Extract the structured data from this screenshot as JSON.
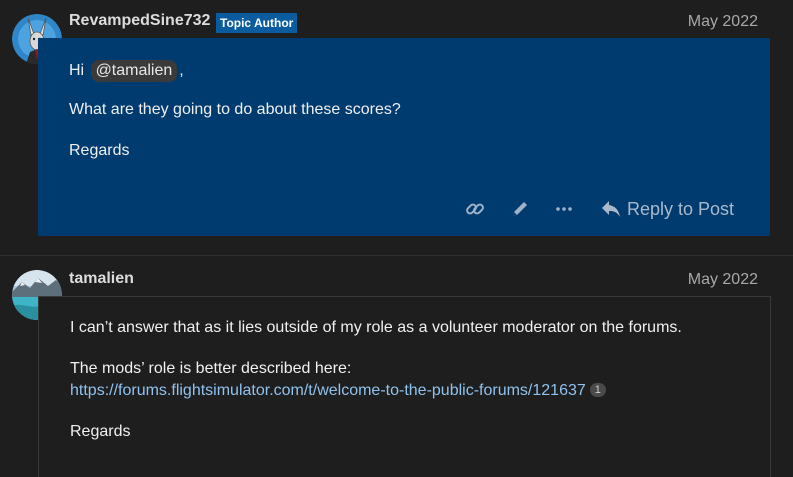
{
  "posts": [
    {
      "username": "RevampedSine732",
      "badge": "Topic Author",
      "date": "May 2022",
      "greeting": "Hi",
      "mention": "@tamalien",
      "greeting_suffix": ",",
      "question": "What are they going to do about these scores?",
      "signoff": "Regards",
      "reply_label": "Reply to Post",
      "avatar_icon": "jackalope-avatar-icon",
      "body_color": "#003b6f"
    },
    {
      "username": "tamalien",
      "date": "May 2022",
      "paragraph1": "I can’t answer that as it lies outside of my role as a volunteer moderator on the forums.",
      "paragraph2": "The mods’ role is better described here:",
      "link": "https://forums.flightsimulator.com/t/welcome-to-the-public-forums/121637",
      "link_clicks": "1",
      "signoff": "Regards",
      "avatar_icon": "landscape-avatar-icon"
    }
  ],
  "colors": {
    "background": "#1e1e1e",
    "badge": "#0a5c9e",
    "link": "#8fc2ee"
  }
}
